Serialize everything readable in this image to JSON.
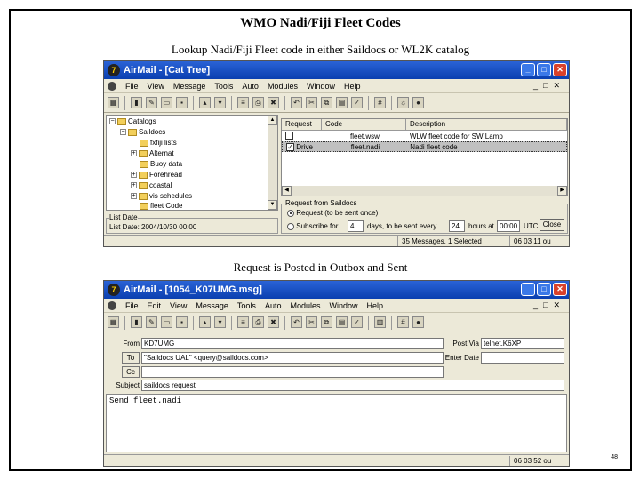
{
  "slide": {
    "title": "WMO Nadi/Fiji Fleet Codes",
    "caption1": "Lookup Nadi/Fiji Fleet code in either Saildocs or WL2K catalog",
    "caption2": "Request is Posted in Outbox and Sent",
    "page_number": "48"
  },
  "win1": {
    "title": "AirMail - [Cat Tree]",
    "menu": [
      "File",
      "View",
      "Message",
      "Tools",
      "Auto",
      "Modules",
      "Window",
      "Help"
    ],
    "tree": {
      "root": "Catalogs",
      "child": "Saildocs",
      "items": [
        "fxfiji lists",
        "Alternat",
        "Buoy data",
        "Forehread",
        "coastal",
        "vis schedules",
        "fleet Code"
      ]
    },
    "list_date_label": "List Date",
    "list_date": "List Date: 2004/10/30 00:00",
    "columns": [
      "Request",
      "Code",
      "Description"
    ],
    "rows": [
      {
        "request": "",
        "code": "fleet.wsw",
        "description": "WLW fleet code for SW Lamp",
        "checked": false
      },
      {
        "request": "Drive",
        "code": "fleet.nadi",
        "description": "Nadi fleet code",
        "checked": true
      }
    ],
    "request_group": "Request from Saildocs",
    "opt1": "Request (to be sent once)",
    "opt2_prefix": "Subscribe for",
    "opt2_days": "4",
    "opt2_mid": "days,  to be sent every",
    "opt2_hours": "24",
    "opt2_at": "hours  at",
    "opt2_time": "00:00",
    "opt2_utc": "UTC",
    "close_btn": "Close",
    "status_messages": "35 Messages, 1 Selected",
    "status_time": "06 03 11 ou"
  },
  "win2": {
    "title": "AirMail - [1054_K07UMG.msg]",
    "menu": [
      "File",
      "Edit",
      "View",
      "Message",
      "Tools",
      "Auto",
      "Modules",
      "Window",
      "Help"
    ],
    "from_label": "From",
    "from_value": "KD7UMG",
    "to_label": "To",
    "to_value": "\"Saildocs UAL\" <query@saildocs.com>",
    "cc_label": "Cc",
    "cc_value": "",
    "subject_label": "Subject",
    "subject_value": "saildocs request",
    "postvia_label": "Post Via",
    "postvia_value": "telnet.K6XP",
    "enter_label": "Enter Date",
    "enter_value": "",
    "body": "Send fleet.nadi",
    "status_time": "06 03 52 ou"
  }
}
